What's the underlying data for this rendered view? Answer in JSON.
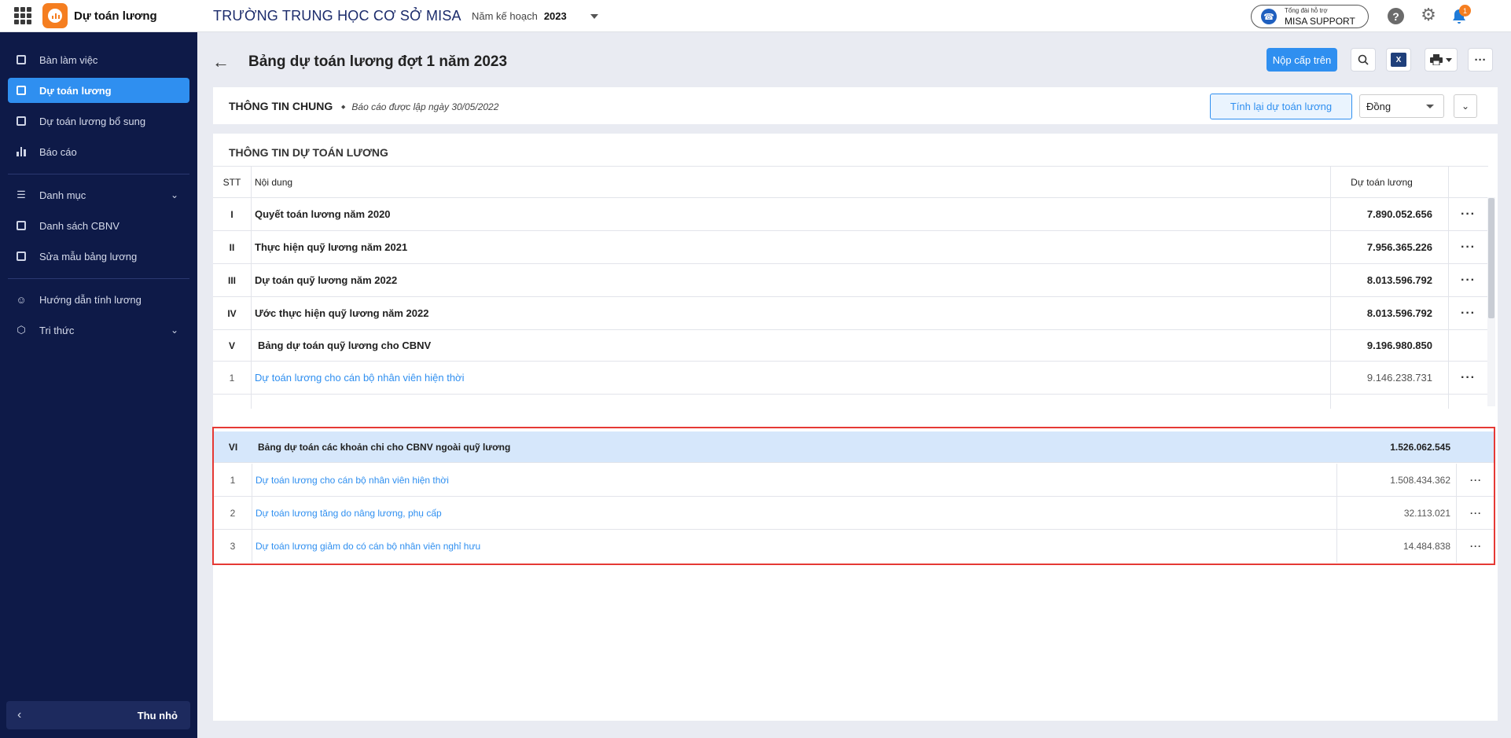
{
  "app": {
    "name": "Dự toán lương",
    "school": "TRƯỜNG TRUNG HỌC CƠ SỞ MISA",
    "plan_year_label": "Năm kế hoạch",
    "plan_year_value": "2023",
    "support_small": "Tổng đài hỗ trợ",
    "support_big": "MISA SUPPORT",
    "notification_count": "1"
  },
  "sidebar": {
    "items": [
      {
        "label": "Bàn làm việc",
        "icon": "dashboard-icon"
      },
      {
        "label": "Dự toán lương",
        "icon": "payroll-icon"
      },
      {
        "label": "Dự toán lương bổ sung",
        "icon": "supplement-icon"
      },
      {
        "label": "Báo cáo",
        "icon": "report-icon"
      },
      {
        "label": "Danh mục",
        "icon": "list-icon"
      },
      {
        "label": "Danh sách CBNV",
        "icon": "staff-icon"
      },
      {
        "label": "Sửa mẫu bảng lương",
        "icon": "template-icon"
      },
      {
        "label": "Hướng dẫn tính lương",
        "icon": "guide-icon"
      },
      {
        "label": "Tri thức",
        "icon": "knowledge-icon"
      }
    ],
    "collapse_label": "Thu nhỏ"
  },
  "page": {
    "title": "Bảng dự toán lương đợt 1 năm 2023",
    "submit_label": "Nộp cấp trên",
    "excel_label": "X"
  },
  "info": {
    "title": "THÔNG TIN CHUNG",
    "subtitle": "Báo cáo được lập ngày 30/05/2022",
    "recalc_label": "Tính lại dự toán lương",
    "currency": "Đồng"
  },
  "table": {
    "section_title": "THÔNG TIN DỰ TOÁN LƯƠNG",
    "headers": {
      "stt": "STT",
      "content": "Nội dung",
      "value": "Dự toán lương"
    },
    "rows": [
      {
        "stt": "I",
        "content": "Quyết toán lương năm 2020",
        "value": "7.890.052.656"
      },
      {
        "stt": "II",
        "content": "Thực hiện quỹ lương năm 2021",
        "value": "7.956.365.226"
      },
      {
        "stt": "III",
        "content": "Dự toán quỹ lương năm 2022",
        "value": "8.013.596.792"
      },
      {
        "stt": "IV",
        "content": "Ước thực hiện quỹ lương năm 2022",
        "value": "8.013.596.792"
      },
      {
        "stt": "V",
        "content": "Bảng dự toán quỹ lương cho CBNV",
        "value": "9.196.980.850"
      },
      {
        "stt": "1",
        "content": "Dự toán lương cho cán bộ nhân viên hiện thời",
        "value": "9.146.238.731"
      }
    ],
    "section_vi": {
      "stt": "VI",
      "content": "Bảng dự toán các khoản chi cho CBNV ngoài quỹ lương",
      "value": "1.526.062.545",
      "rows": [
        {
          "stt": "1",
          "content": "Dự toán lương cho cán bộ nhân viên hiện thời",
          "value": "1.508.434.362"
        },
        {
          "stt": "2",
          "content": "Dự toán lương tăng do nâng lương, phụ cấp",
          "value": "32.113.021"
        },
        {
          "stt": "3",
          "content": "Dự toán lương giảm do có cán bộ nhân viên nghỉ hưu",
          "value": "14.484.838"
        }
      ]
    },
    "more_label": "···"
  },
  "colors": {
    "accent": "#2f8ff0",
    "sidebar": "#0e1a48",
    "highlight": "#e53935",
    "brand": "#f57e20"
  }
}
